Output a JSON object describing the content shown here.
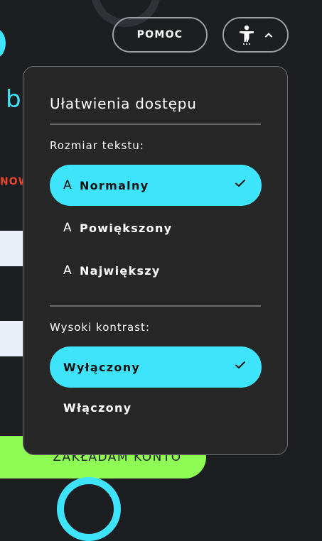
{
  "header": {
    "help_label": "POMOC",
    "accessibility_icon": "accessibility-person-icon",
    "chevron_icon": "chevron-up-icon"
  },
  "background": {
    "letter": "b",
    "badge": "NOW",
    "register_label": "ZAKŁADAM KONTO"
  },
  "panel": {
    "title": "Ułatwienia dostępu",
    "text_size_label": "Rozmiar tekstu:",
    "text_size_options": [
      {
        "glyph": "A",
        "label": "Normalny",
        "selected": true
      },
      {
        "glyph": "A",
        "label": "Powiększony",
        "selected": false
      },
      {
        "glyph": "A",
        "label": "Największy",
        "selected": false
      }
    ],
    "contrast_label": "Wysoki kontrast:",
    "contrast_options": [
      {
        "label": "Wyłączony",
        "selected": true
      },
      {
        "label": "Włączony",
        "selected": false
      }
    ]
  },
  "colors": {
    "accent": "#3ee4fb",
    "panel_bg": "#282727",
    "page_bg": "#1c1e21",
    "register_green": "#8efc54",
    "badge_red": "#e8442c"
  }
}
